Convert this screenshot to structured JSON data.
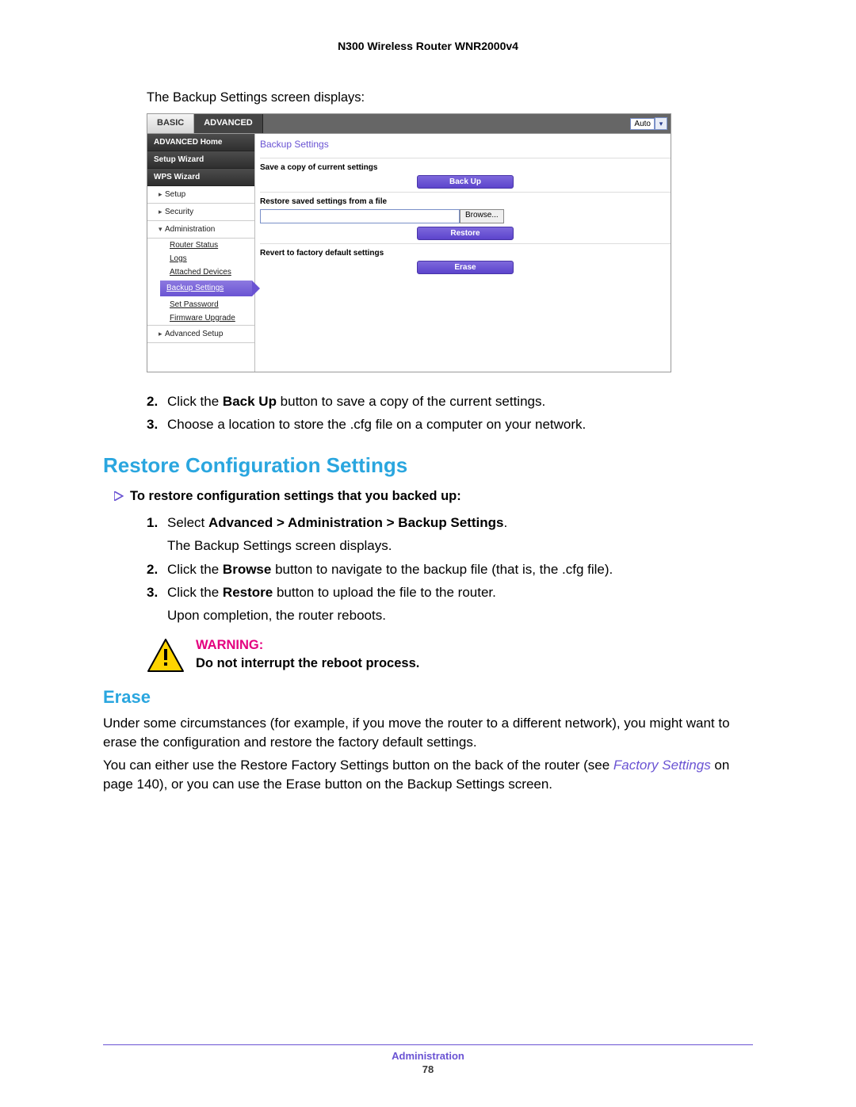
{
  "doc_title": "N300 Wireless Router WNR2000v4",
  "intro": "The Backup Settings screen displays:",
  "shot": {
    "tabs": {
      "basic": "BASIC",
      "advanced": "ADVANCED"
    },
    "dropdown_label": "Auto",
    "sidebar": {
      "home": "ADVANCED Home",
      "wizard": "Setup Wizard",
      "wps": "WPS Wizard",
      "setup": "Setup",
      "security": "Security",
      "admin": "Administration",
      "advsetup": "Advanced Setup",
      "sub": {
        "status": "Router Status",
        "logs": "Logs",
        "attached": "Attached Devices",
        "backup": "Backup Settings",
        "password": "Set Password",
        "firmware": "Firmware Upgrade"
      }
    },
    "main": {
      "title": "Backup Settings",
      "save_label": "Save a copy of current settings",
      "backup_btn": "Back Up",
      "restore_label": "Restore saved settings from a file",
      "browse_btn": "Browse...",
      "restore_btn": "Restore",
      "revert_label": "Revert to factory default settings",
      "erase_btn": "Erase"
    }
  },
  "steps_top": {
    "s2_num": "2.",
    "s2_a": "Click the ",
    "s2_b": "Back Up",
    "s2_c": " button to save a copy of the current settings.",
    "s3_num": "3.",
    "s3": "Choose a location to store the .cfg file on a computer on your network."
  },
  "restore": {
    "heading": "Restore Configuration Settings",
    "lead": "To restore configuration settings that you backed up:",
    "s1_num": "1.",
    "s1_a": "Select ",
    "s1_b": "Advanced > Administration > Backup Settings",
    "s1_c": ".",
    "s1_follow": "The Backup Settings screen displays.",
    "s2_num": "2.",
    "s2_a": "Click the ",
    "s2_b": "Browse",
    "s2_c": " button to navigate to the backup file (that is, the .cfg file).",
    "s3_num": "3.",
    "s3_a": "Click the ",
    "s3_b": "Restore",
    "s3_c": " button to upload the file to the router.",
    "s3_follow": "Upon completion, the router reboots."
  },
  "warning": {
    "head": "WARNING:",
    "body": "Do not interrupt the reboot process."
  },
  "erase": {
    "heading": "Erase",
    "p1": "Under some circumstances (for example, if you move the router to a different network), you might want to erase the configuration and restore the factory default settings.",
    "p2_a": "You can either use the Restore Factory Settings button on the back of the router (see ",
    "p2_link": "Factory Settings",
    "p2_b": " on page 140), or you can use the Erase button on the Backup Settings screen."
  },
  "footer": {
    "label": "Administration",
    "page": "78"
  }
}
